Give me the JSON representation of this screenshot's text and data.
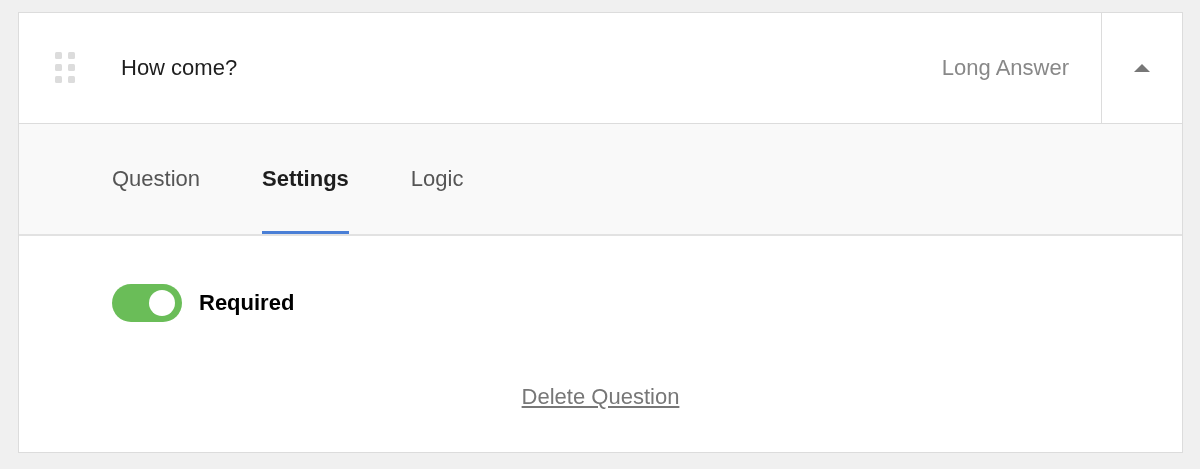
{
  "question": {
    "title": "How come?",
    "type": "Long Answer",
    "expanded": true
  },
  "tabs": [
    {
      "label": "Question",
      "selected": false
    },
    {
      "label": "Settings",
      "selected": true
    },
    {
      "label": "Logic",
      "selected": false
    }
  ],
  "settings": [
    {
      "kind": "toggle",
      "label": "Required",
      "on": true
    }
  ],
  "delete_link": "Delete Question"
}
